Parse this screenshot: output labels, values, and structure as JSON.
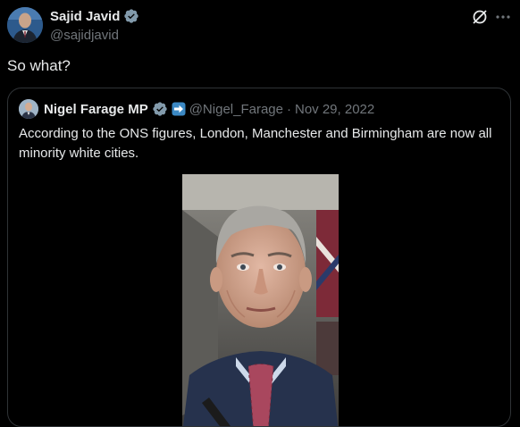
{
  "tweet": {
    "author_name": "Sajid Javid",
    "author_handle": "@sajidjavid",
    "text": "So what?",
    "verified_icon": "verified-badge-icon",
    "actions": {
      "grok_icon": "grok-icon",
      "more_icon": "more-icon"
    }
  },
  "quote": {
    "author_name": "Nigel Farage MP",
    "author_handle": "@Nigel_Farage",
    "separator": "·",
    "date": "Nov 29, 2022",
    "text": "According to the ONS figures, London, Manchester and Birmingham are now all minority white cities.",
    "icons": [
      "verified-badge-icon",
      "arrow-emoji-icon"
    ]
  },
  "colors": {
    "background": "#000000",
    "text_primary": "#e7e9ea",
    "text_secondary": "#71767b",
    "verified": "#829aab",
    "border": "#2f3336"
  }
}
